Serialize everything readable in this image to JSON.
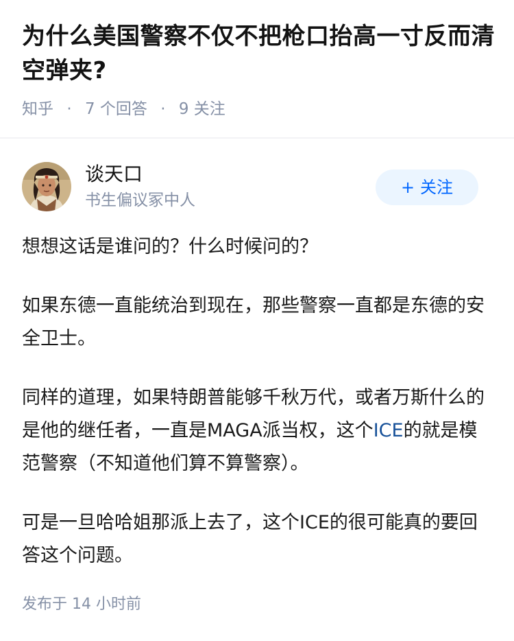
{
  "question": {
    "title": "为什么美国警察不仅不把枪口抬高一寸反而清空弹夹?",
    "source": "知乎",
    "answer_count": "7 个回答",
    "follow_count": "9 关注",
    "separator": "·"
  },
  "author": {
    "name": "谈天口",
    "bio": "书生偏议冢中人",
    "avatar_icon": "avatar-portrait-icon"
  },
  "follow_button": {
    "plus": "+",
    "label": "关注"
  },
  "answer": {
    "paragraphs": [
      "想想这话是谁问的？什么时候问的？",
      "如果东德一直能统治到现在，那些警察一直都是东德的安全卫士。",
      {
        "before": "同样的道理，如果特朗普能够千秋万代，或者万斯什么的是他的继任者，一直是MAGA派当权，这个",
        "highlight": "ICE",
        "after": "的就是模范警察（不知道他们算不算警察）。"
      },
      "可是一旦哈哈姐那派上去了，这个ICE的很可能真的要回答这个问题。"
    ]
  },
  "meta": {
    "published": "发布于  14 小时前"
  },
  "colors": {
    "accent": "#0066ff",
    "follow_bg": "#ebf5ff",
    "meta_text": "#8590a6",
    "link": "#175199"
  }
}
